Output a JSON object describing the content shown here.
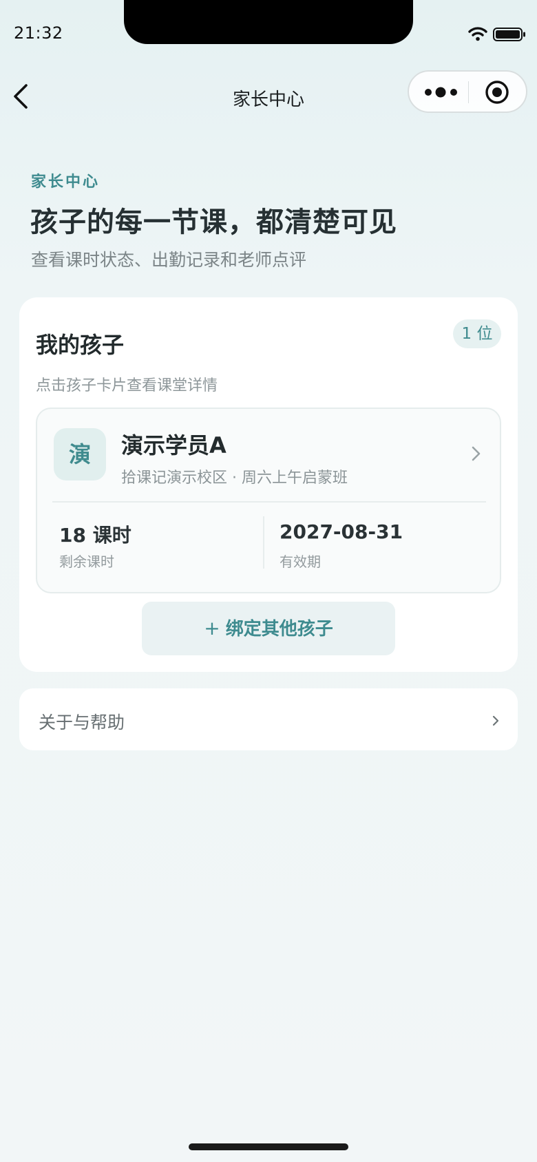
{
  "status_bar": {
    "time": "21:32"
  },
  "nav": {
    "title": "家长中心"
  },
  "hero": {
    "kicker": "家长中心",
    "title": "孩子的每一节课，都清楚可见",
    "subtitle": "查看课时状态、出勤记录和老师点评"
  },
  "children_card": {
    "title": "我的孩子",
    "count_badge": "1 位",
    "hint": "点击孩子卡片查看课堂详情",
    "children": [
      {
        "avatar_char": "演",
        "name": "演示学员A",
        "meta": "拾课记演示校区 · 周六上午启蒙班",
        "remaining_value": "18 课时",
        "remaining_label": "剩余课时",
        "expiry_value": "2027-08-31",
        "expiry_label": "有效期"
      }
    ],
    "bind_button": {
      "plus": "+",
      "label": "绑定其他孩子"
    }
  },
  "help_row": {
    "label": "关于与帮助"
  },
  "colors": {
    "accent": "#3e8b8f",
    "card": "#ffffff",
    "background": "#eef5f6"
  },
  "icons": [
    "back-arrow-icon",
    "more-dots-icon",
    "target-icon",
    "wifi-icon",
    "battery-icon",
    "chevron-right-icon"
  ]
}
